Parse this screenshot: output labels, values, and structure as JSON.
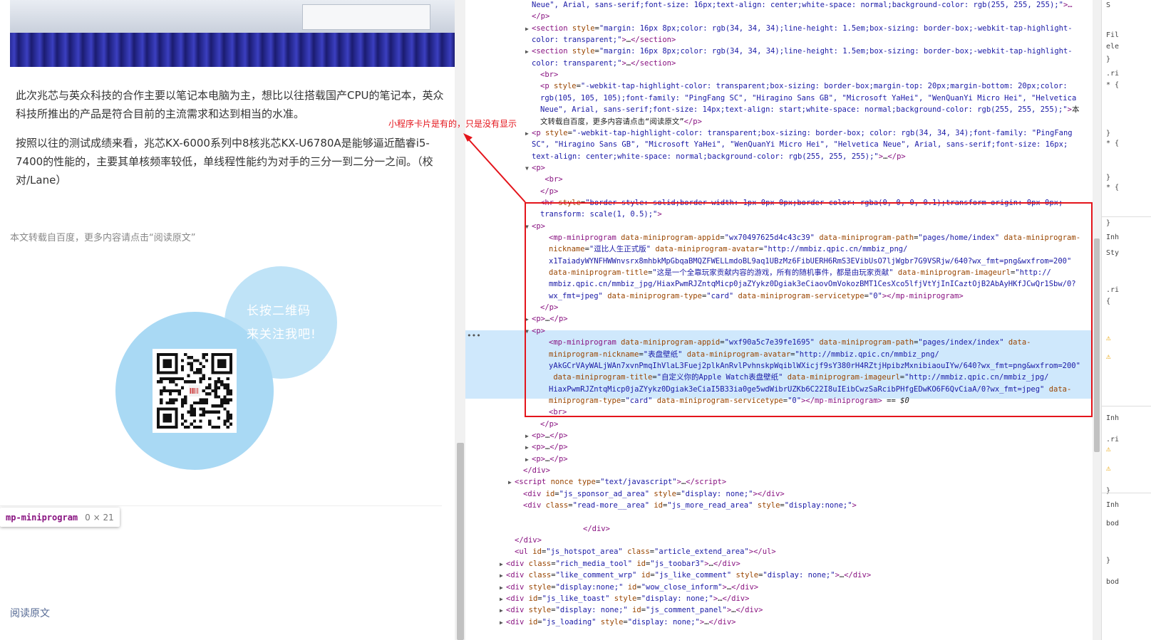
{
  "article": {
    "para1": "此次兆芯与英众科技的合作主要以笔记本电脑为主，想比以往搭载国产CPU的笔记本，英众科技所推出的产品是符合目前的主流需求和达到相当的水准。",
    "para2": "按照以往的测试成绩来看，兆芯KX-6000系列中8核兆芯KX-U6780A是能够逼近酷睿i5-7400的性能的，主要其单核频率较低，单线程性能约为对手的三分一到二分一之间。（校对/Lane）",
    "source_note": "本文转载自百度，更多内容请点击“阅读原文”",
    "qr_line1": "长按二维码",
    "qr_line2": "来关注我吧!",
    "read_original": "阅读原文"
  },
  "inspect_tip": {
    "tag": "mp-miniprogram",
    "size": "0 × 21"
  },
  "annotation": "小程序卡片是有的，只是没有显示",
  "elements": {
    "lines": [
      {
        "indent": 8,
        "tri": "",
        "html": "<span class='v'>Neue\", Arial, sans-serif;font-size: 16px;text-align: center;white-space: normal;background-color: rgb(255, 255, 255);\"</span><span class='t'>&gt;…</span>"
      },
      {
        "indent": 8,
        "tri": "",
        "html": "<span class='t'>&lt;/p&gt;</span>"
      },
      {
        "indent": 8,
        "tri": "▶",
        "html": "<span class='t'>&lt;section</span> <span class='a'>style</span>=<span class='v'>\"margin: 16px 8px;color: rgb(34, 34, 34);line-height: 1.5em;box-sizing: border-box;-webkit-tap-highlight-</span>"
      },
      {
        "indent": 8,
        "tri": "",
        "html": "<span class='v'>color: transparent;\"</span><span class='t'>&gt;</span>…<span class='t'>&lt;/section&gt;</span>"
      },
      {
        "indent": 8,
        "tri": "▶",
        "html": "<span class='t'>&lt;section</span> <span class='a'>style</span>=<span class='v'>\"margin: 16px 8px;color: rgb(34, 34, 34);line-height: 1.5em;box-sizing: border-box;-webkit-tap-highlight-</span>"
      },
      {
        "indent": 8,
        "tri": "",
        "html": "<span class='v'>color: transparent;\"</span><span class='t'>&gt;</span>…<span class='t'>&lt;/section&gt;</span>"
      },
      {
        "indent": 9,
        "tri": "",
        "html": "<span class='t'>&lt;br&gt;</span>"
      },
      {
        "indent": 9,
        "tri": "",
        "html": "<span class='t'>&lt;p</span> <span class='a'>style</span>=<span class='v'>\"-webkit-tap-highlight-color: transparent;box-sizing: border-box;margin-top: 20px;margin-bottom: 20px;color:</span>"
      },
      {
        "indent": 9,
        "tri": "",
        "html": "<span class='v'>rgb(105, 105, 105);font-family: \"PingFang SC\", \"Hiragino Sans GB\", \"Microsoft YaHei\", \"WenQuanYi Micro Hei\", \"Helvetica</span>"
      },
      {
        "indent": 9,
        "tri": "",
        "html": "<span class='v'>Neue\", Arial, sans-serif;font-size: 14px;text-align: start;white-space: normal;background-color: rgb(255, 255, 255);\"</span><span class='t'>&gt;</span>本"
      },
      {
        "indent": 9,
        "tri": "",
        "html": "文转载自百度，更多内容请点击“阅读原文”<span class='t'>&lt;/p&gt;</span>"
      },
      {
        "indent": 8,
        "tri": "▶",
        "html": "<span class='t'>&lt;p</span> <span class='a'>style</span>=<span class='v'>\"-webkit-tap-highlight-color: transparent;box-sizing: border-box; color: rgb(34, 34, 34);font-family: \"PingFang</span>"
      },
      {
        "indent": 8,
        "tri": "",
        "html": "<span class='v'>SC\", \"Hiragino Sans GB\", \"Microsoft YaHei\", \"WenQuanYi Micro Hei\", \"Helvetica Neue\", Arial, sans-serif;font-size: 16px;</span>"
      },
      {
        "indent": 8,
        "tri": "",
        "html": "<span class='v'>text-align: center;white-space: normal;background-color: rgb(255, 255, 255);\"</span><span class='t'>&gt;</span>…<span class='t'>&lt;/p&gt;</span>"
      },
      {
        "indent": 8,
        "tri": "▼",
        "html": "<span class='t'>&lt;p&gt;</span>"
      },
      {
        "indent": 9,
        "tri": "",
        "html": "  <span class='t'>&lt;br&gt;</span>"
      },
      {
        "indent": 9,
        "tri": "",
        "html": "<span class='t'>&lt;/p&gt;</span>"
      },
      {
        "indent": 9,
        "tri": "",
        "html": "<span class='t'>&lt;hr</span> <span class='a'>style</span>=<span class='v'>\"border-style: solid;border-width: 1px 0px 0px;border-color: rgba(0, 0, 0, 0.1);transform-origin: 0px 0px;</span>"
      },
      {
        "indent": 9,
        "tri": "",
        "html": "<span class='v'>transform: scale(1, 0.5);\"</span><span class='t'>&gt;</span>"
      },
      {
        "indent": 8,
        "tri": "▼",
        "html": "<span class='t'>&lt;p&gt;</span>"
      },
      {
        "indent": 10,
        "tri": "",
        "html": "<span class='t'>&lt;mp-miniprogram</span> <span class='a'>data-miniprogram-appid</span>=<span class='v'>\"wx70497625d4c43c39\"</span> <span class='a'>data-miniprogram-path</span>=<span class='v'>\"pages/home/index\"</span> <span class='a'>data-miniprogram-</span>"
      },
      {
        "indent": 10,
        "tri": "",
        "html": "<span class='a'>nickname</span>=<span class='v'>\"逗比人生正式版\"</span> <span class='a'>data-miniprogram-avatar</span>=<span class='v'>\"http://mmbiz.qpic.cn/mmbiz_png/</span>"
      },
      {
        "indent": 10,
        "tri": "",
        "html": "<span class='v'>x1TaiadyWYNFHWWnvsrx8mhbkMpGbqaBMQZFWELLmdoBL9aq1UBzMz6FibUERH6RmS3EVibUsO7ljWgbr7G9VSRjw/640?wx_fmt=png&amp;wxfrom=200\"</span>"
      },
      {
        "indent": 10,
        "tri": "",
        "html": "<span class='a'>data-miniprogram-title</span>=<span class='v'>\"这是一个全靠玩家贡献内容的游戏，所有的随机事件，都是由玩家贡献\"</span> <span class='a'>data-miniprogram-imageurl</span>=<span class='v'>\"http://</span>"
      },
      {
        "indent": 10,
        "tri": "",
        "html": "<span class='v'>mmbiz.qpic.cn/mmbiz_jpg/HiaxPwmRJZntqMicp0jaZYykz0Dgiak3eCiaovOmVokozBMT1CesXco5lfjVtYjInICaztOjB2AbAyHKfJCwQr1Sbw/0?</span>"
      },
      {
        "indent": 10,
        "tri": "",
        "html": "<span class='v'>wx_fmt=jpeg\"</span> <span class='a'>data-miniprogram-type</span>=<span class='v'>\"card\"</span> <span class='a'>data-miniprogram-servicetype</span>=<span class='v'>\"0\"</span><span class='t'>&gt;&lt;/mp-miniprogram&gt;</span>"
      },
      {
        "indent": 9,
        "tri": "",
        "html": "<span class='t'>&lt;/p&gt;</span>"
      },
      {
        "indent": 8,
        "tri": "▶",
        "html": "<span class='t'>&lt;p&gt;</span>…<span class='t'>&lt;/p&gt;</span>"
      },
      {
        "indent": 8,
        "tri": "▼",
        "html": "<span class='t'>&lt;p&gt;</span>"
      },
      {
        "indent": 10,
        "tri": "",
        "html": "<span class='t'>&lt;mp-miniprogram</span> <span class='a'>data-miniprogram-appid</span>=<span class='v'>\"wxf90a5c7e39fe1695\"</span> <span class='a'>data-miniprogram-path</span>=<span class='v'>\"pages/index/index\"</span> <span class='a'>data-</span>"
      },
      {
        "indent": 10,
        "tri": "",
        "html": "<span class='a'>miniprogram-nickname</span>=<span class='v'>\"表盘壁纸\"</span> <span class='a'>data-miniprogram-avatar</span>=<span class='v'>\"http://mmbiz.qpic.cn/mmbiz_png/</span>"
      },
      {
        "indent": 10,
        "tri": "",
        "html": "<span class='v'>yAkGCrVAyWALjWAn7xvnPmqIhVlaL3Fuej2plkAnRvlPvhnskpWqiblWXicjf9sY380rH4RZtjHpibzMxnibiaouIYw/640?wx_fmt=png&amp;wxfrom=200\"</span>"
      },
      {
        "indent": 10,
        "tri": "",
        "html": " <span class='a'>data-miniprogram-title</span>=<span class='v'>\"自定义你的Apple Watch表盘壁纸\"</span> <span class='a'>data-miniprogram-imageurl</span>=<span class='v'>\"http://mmbiz.qpic.cn/mmbiz_jpg/</span>"
      },
      {
        "indent": 10,
        "tri": "",
        "html": "<span class='v'>HiaxPwmRJZntqMicp0jaZYykz0Dgiak3eCiaI5B33ia0ge5wdWibrUZKb6C22I8uIEibCwzSaRcibPHfgEDwKO6F6QvCiaA/0?wx_fmt=jpeg\"</span> <span class='a'>data-</span>"
      },
      {
        "indent": 10,
        "tri": "",
        "html": "<span class='a'>miniprogram-type</span>=<span class='v'>\"card\"</span> <span class='a'>data-miniprogram-servicetype</span>=<span class='v'>\"0\"</span><span class='t'>&gt;&lt;/mp-miniprogram&gt;</span> == <i>$0</i>"
      },
      {
        "indent": 10,
        "tri": "",
        "html": "<span class='t'>&lt;br&gt;</span>"
      },
      {
        "indent": 9,
        "tri": "",
        "html": "<span class='t'>&lt;/p&gt;</span>"
      },
      {
        "indent": 8,
        "tri": "▶",
        "html": "<span class='t'>&lt;p&gt;</span>…<span class='t'>&lt;/p&gt;</span>"
      },
      {
        "indent": 8,
        "tri": "▶",
        "html": "<span class='t'>&lt;p&gt;</span>…<span class='t'>&lt;/p&gt;</span>"
      },
      {
        "indent": 8,
        "tri": "▶",
        "html": "<span class='t'>&lt;p&gt;</span>…<span class='t'>&lt;/p&gt;</span>"
      },
      {
        "indent": 7,
        "tri": "",
        "html": "<span class='t'>&lt;/div&gt;</span>"
      },
      {
        "indent": 6,
        "tri": "▶",
        "html": "<span class='t'>&lt;script</span> <span class='a'>nonce</span> <span class='a'>type</span>=<span class='v'>\"text/javascript\"</span><span class='t'>&gt;</span>…<span class='t'>&lt;/script&gt;</span>"
      },
      {
        "indent": 7,
        "tri": "",
        "html": "<span class='t'>&lt;div</span> <span class='a'>id</span>=<span class='v'>\"js_sponsor_ad_area\"</span> <span class='a'>style</span>=<span class='v'>\"display: none;\"</span><span class='t'>&gt;&lt;/div&gt;</span>"
      },
      {
        "indent": 7,
        "tri": "",
        "html": "<span class='t'>&lt;div</span> <span class='a'>class</span>=<span class='v'>\"read-more__area\"</span> <span class='a'>id</span>=<span class='v'>\"js_more_read_area\"</span> <span class='a'>style</span>=<span class='v'>\"display:none;\"</span><span class='t'>&gt;</span>"
      },
      {
        "indent": 0,
        "tri": "",
        "html": " "
      },
      {
        "indent": 14,
        "tri": "",
        "html": "<span class='t'>&lt;/div&gt;</span>"
      },
      {
        "indent": 6,
        "tri": "",
        "html": "<span class='t'>&lt;/div&gt;</span>"
      },
      {
        "indent": 6,
        "tri": "",
        "html": "<span class='t'>&lt;ul</span> <span class='a'>id</span>=<span class='v'>\"js_hotspot_area\"</span> <span class='a'>class</span>=<span class='v'>\"article_extend_area\"</span><span class='t'>&gt;&lt;/ul&gt;</span>"
      },
      {
        "indent": 5,
        "tri": "▶",
        "html": "<span class='t'>&lt;div</span> <span class='a'>class</span>=<span class='v'>\"rich_media_tool\"</span> <span class='a'>id</span>=<span class='v'>\"js_toobar3\"</span><span class='t'>&gt;</span>…<span class='t'>&lt;/div&gt;</span>"
      },
      {
        "indent": 5,
        "tri": "▶",
        "html": "<span class='t'>&lt;div</span> <span class='a'>class</span>=<span class='v'>\"like_comment_wrp\"</span> <span class='a'>id</span>=<span class='v'>\"js_like_comment\"</span> <span class='a'>style</span>=<span class='v'>\"display: none;\"</span><span class='t'>&gt;</span>…<span class='t'>&lt;/div&gt;</span>"
      },
      {
        "indent": 5,
        "tri": "▶",
        "html": "<span class='t'>&lt;div</span> <span class='a'>style</span>=<span class='v'>\"display:none;\"</span> <span class='a'>id</span>=<span class='v'>\"wow_close_inform\"</span><span class='t'>&gt;</span>…<span class='t'>&lt;/div&gt;</span>"
      },
      {
        "indent": 5,
        "tri": "▶",
        "html": "<span class='t'>&lt;div</span> <span class='a'>id</span>=<span class='v'>\"js_like_toast\"</span> <span class='a'>style</span>=<span class='v'>\"display: none;\"</span><span class='t'>&gt;</span>…<span class='t'>&lt;/div&gt;</span>"
      },
      {
        "indent": 5,
        "tri": "▶",
        "html": "<span class='t'>&lt;div</span> <span class='a'>style</span>=<span class='v'>\"display: none;\"</span> <span class='a'>id</span>=<span class='v'>\"js_comment_panel\"</span><span class='t'>&gt;</span>…<span class='t'>&lt;/div&gt;</span>"
      },
      {
        "indent": 5,
        "tri": "▶",
        "html": "<span class='t'>&lt;div</span> <span class='a'>id</span>=<span class='v'>\"js_loading\"</span> <span class='a'>style</span>=<span class='v'>\"display: none;\"</span><span class='t'>&gt;</span>…<span class='t'>&lt;/div&gt;</span>"
      }
    ]
  },
  "styles_pane": {
    "lines": [
      "S",
      "Fil",
      "ele",
      "}",
      ".ri",
      "* {",
      "}",
      "* {",
      "}",
      "* {",
      "}",
      "Inh",
      "Sty",
      ".ri",
      "{",
      "Inh",
      ".ri",
      "}",
      "Inh",
      "bod",
      "}",
      "bod"
    ],
    "warn_icon": "warning-icon",
    "accent_red": "#e4141b"
  }
}
